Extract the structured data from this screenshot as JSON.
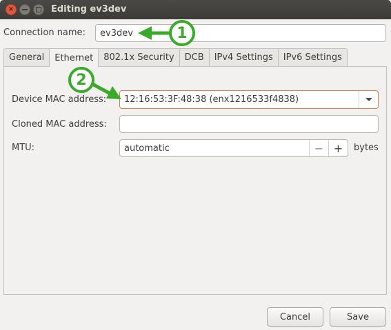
{
  "window": {
    "title": "Editing ev3dev",
    "close_glyph": "×"
  },
  "connection": {
    "label": "Connection name:",
    "value": "ev3dev"
  },
  "tabs": [
    {
      "label": "General",
      "active": false
    },
    {
      "label": "Ethernet",
      "active": true
    },
    {
      "label": "802.1x Security",
      "active": false
    },
    {
      "label": "DCB",
      "active": false
    },
    {
      "label": "IPv4 Settings",
      "active": false
    },
    {
      "label": "IPv6 Settings",
      "active": false
    }
  ],
  "ethernet": {
    "device_mac_label": "Device MAC address:",
    "device_mac_value": "12:16:53:3F:48:38 (enx1216533f4838)",
    "cloned_mac_label": "Cloned MAC address:",
    "cloned_mac_value": "",
    "mtu_label": "MTU:",
    "mtu_value": "automatic",
    "mtu_minus": "−",
    "mtu_plus": "+",
    "mtu_unit": "bytes"
  },
  "buttons": {
    "cancel": "Cancel",
    "save": "Save"
  },
  "annotations": {
    "badge_1": "1",
    "badge_2": "2",
    "color": "#3aaa2a"
  },
  "colors": {
    "titlebar": "#3c3b37",
    "close_button": "#e0573d",
    "focus_border": "#e07a4f",
    "background": "#f2f1f0"
  }
}
